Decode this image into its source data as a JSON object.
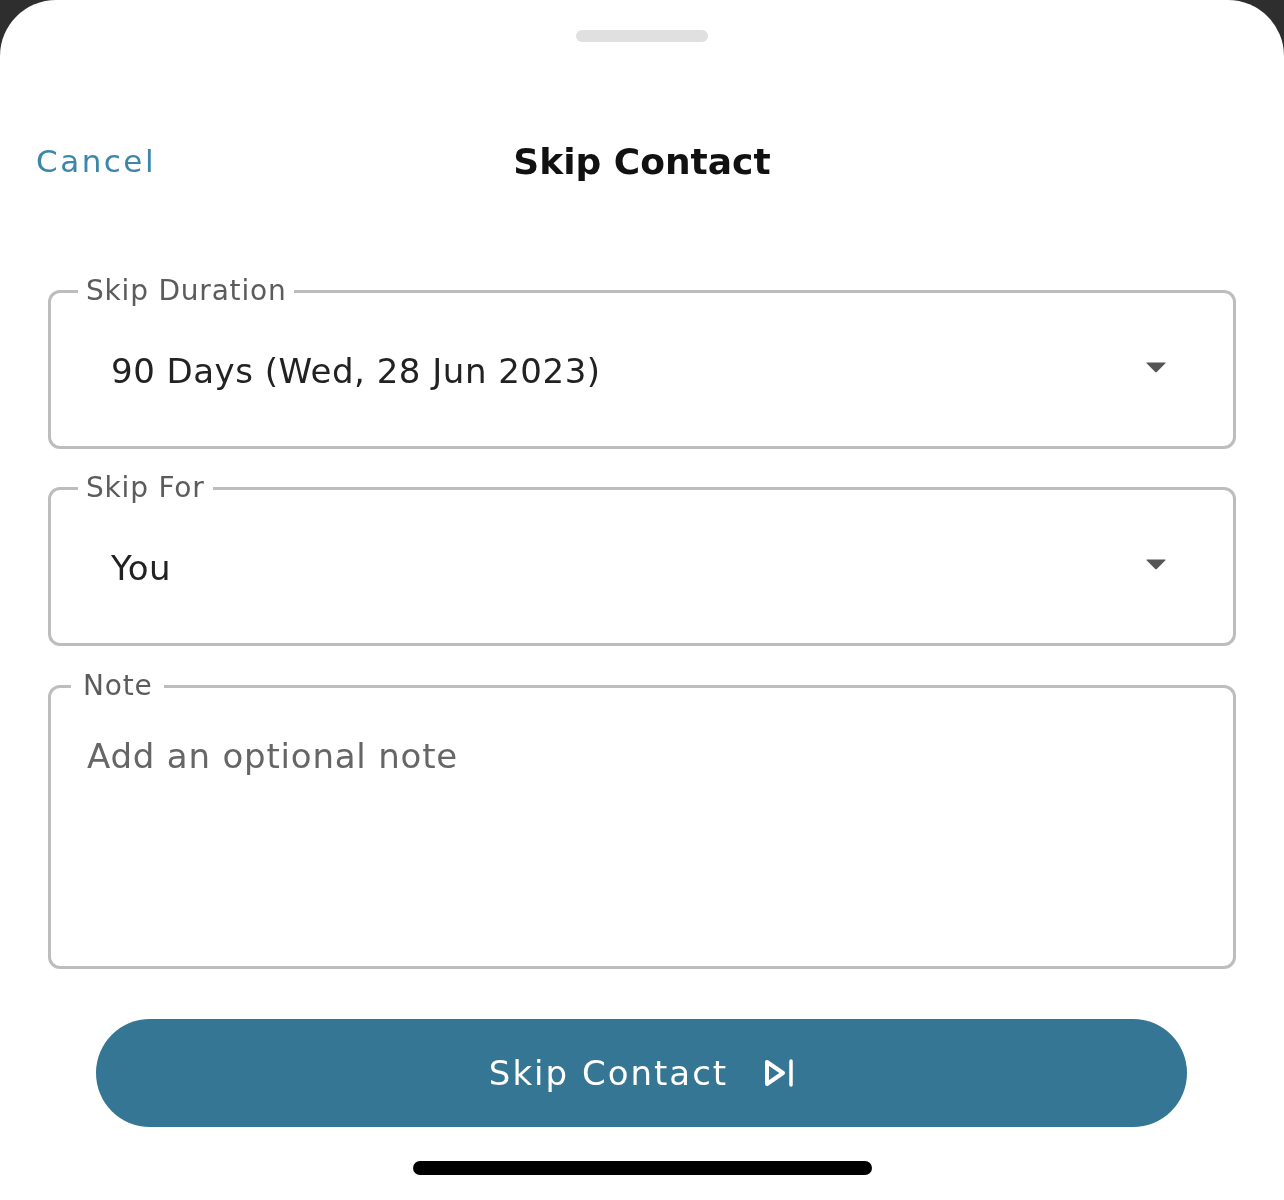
{
  "sheet": {
    "cancel": "Cancel",
    "title": "Skip Contact"
  },
  "fields": [
    {
      "kind": "select",
      "label": "Skip Duration",
      "value": "90 Days (Wed, 28 Jun 2023)"
    },
    {
      "kind": "select",
      "label": "Skip For",
      "value": "You"
    },
    {
      "kind": "textarea",
      "label": "Note",
      "placeholder": "Add an optional note"
    }
  ],
  "primary_button": {
    "label": "Skip Contact"
  }
}
